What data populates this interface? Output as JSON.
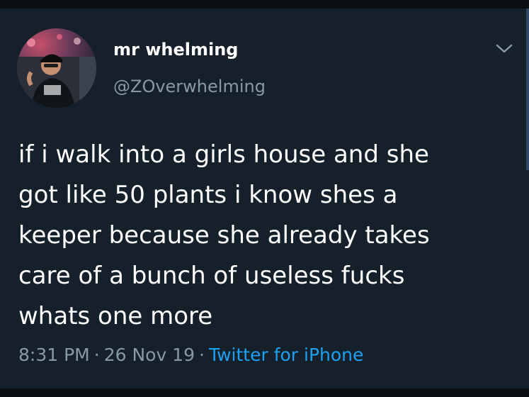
{
  "tweet": {
    "author": {
      "display_name": "mr whelming",
      "handle": "@ZOverwhelming",
      "avatar_icon": "user-avatar"
    },
    "menu_icon": "chevron-down-icon",
    "text_lines": [
      "if i walk into a girls house and she",
      "got like 50 plants i know shes a",
      "keeper because she already takes",
      "care of a bunch of useless fucks",
      "whats one more"
    ],
    "time": "8:31 PM",
    "separator": "·",
    "date": "26 Nov 19",
    "source": "Twitter for iPhone"
  },
  "colors": {
    "background": "#15202b",
    "text": "#ffffff",
    "secondary_text": "#8899a6",
    "accent": "#1da1f2"
  }
}
